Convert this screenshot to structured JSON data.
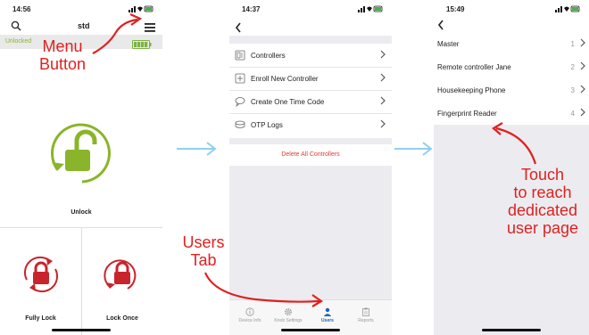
{
  "screen1": {
    "time": "14:56",
    "title": "std",
    "status_left": "Unlocked",
    "unlock_label": "Unlock",
    "fully_lock_label": "Fully Lock",
    "lock_once_label": "Lock Once"
  },
  "screen2": {
    "time": "14:37",
    "menu": [
      {
        "label": "Controllers"
      },
      {
        "label": "Enroll New Controller"
      },
      {
        "label": "Create One Time Code"
      },
      {
        "label": "OTP Logs"
      }
    ],
    "delete_label": "Delete All Controllers",
    "tabs": [
      {
        "label": "Device Info"
      },
      {
        "label": "Knob Settings"
      },
      {
        "label": "Users"
      },
      {
        "label": "Reports"
      }
    ]
  },
  "screen3": {
    "time": "15:49",
    "users": [
      {
        "name": "Master",
        "index": "1"
      },
      {
        "name": "Remote controller Jane",
        "index": "2"
      },
      {
        "name": "Housekeeping Phone",
        "index": "3"
      },
      {
        "name": "Fingerprint Reader",
        "index": "4"
      }
    ]
  },
  "annotations": {
    "menu_button_line1": "Menu",
    "menu_button_line2": "Button",
    "users_tab_line1": "Users",
    "users_tab_line2": "Tab",
    "touch_line1": "Touch",
    "touch_line2": "to reach",
    "touch_line3": "dedicated",
    "touch_line4": "user page"
  },
  "colors": {
    "accent_green": "#8ab52a",
    "lock_red": "#c8242b",
    "delete_red": "#e53935",
    "annotation_red": "#e02020",
    "arrow_blue": "#8fd0ee",
    "tab_active_blue": "#1565c0"
  }
}
